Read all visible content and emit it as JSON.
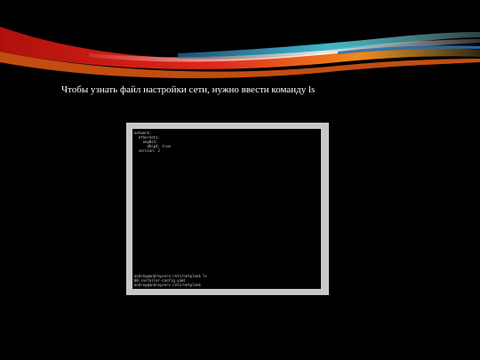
{
  "caption": "Чтобы узнать файл настройки сети, нужно ввести команду ls",
  "terminal": {
    "config_lines": [
      "network:",
      "  ethernets:",
      "    enp0s3:",
      "      dhcp4: true",
      "  version: 2"
    ],
    "command_lines": [
      "andrey@andreyserv:/etc/netplan$ ls",
      "00-installer-config.yaml",
      "andrey@andreyserv:/etc/netplan$"
    ]
  },
  "colors": {
    "background": "#000000",
    "frame": "#c8c8c4",
    "terminal_text": "#cfcfcf",
    "swoosh_red": "#d8241c",
    "swoosh_orange": "#f08a1c",
    "swoosh_teal": "#3fb8c8",
    "swoosh_blue": "#2a6ea8"
  }
}
